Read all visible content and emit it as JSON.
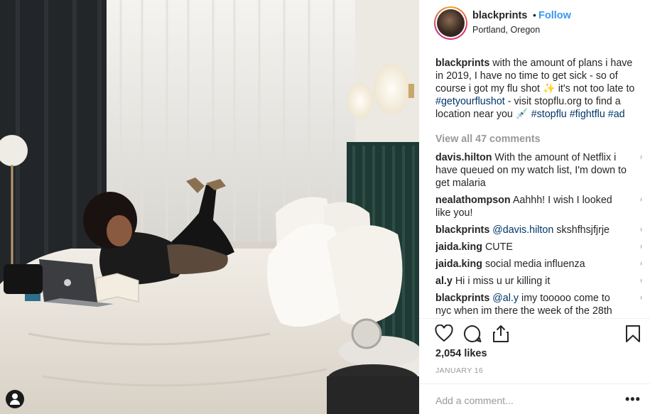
{
  "post": {
    "username": "blackprints",
    "dot": "•",
    "follow_label": "Follow",
    "location": "Portland, Oregon"
  },
  "caption": {
    "username": "blackprints",
    "text_1": "with the amount of plans i have in 2019, I have no time to get sick - so of course i got my flu shot ✨ it's not too late to",
    "tag_1": "#getyourflushot",
    "text_2": "- visit stopflu.org to find a location near you 💉",
    "tag_2": "#stopflu",
    "tag_3": "#fightflu",
    "tag_4": "#ad"
  },
  "view_all_label": "View all 47 comments",
  "comments": [
    {
      "user": "davis.hilton",
      "text": "With the amount of Netflix i have queued on my watch list, I'm down to get malaria"
    },
    {
      "user": "nealathompson",
      "text": "Aahhh! I wish I looked like you!"
    },
    {
      "user": "blackprints",
      "mention": "@davis.hilton",
      "text": "skshfhsjfjrje"
    },
    {
      "user": "jaida.king",
      "text": "CUTE"
    },
    {
      "user": "jaida.king",
      "text": "social media influenza"
    },
    {
      "user": "al.y",
      "text": "Hi i miss u ur killing it"
    },
    {
      "user": "blackprints",
      "mention": "@al.y",
      "text": "imy tooooo come to nyc when im there the week of the 28th"
    }
  ],
  "likes": "2,054 likes",
  "date": "JANUARY 16",
  "add_comment_placeholder": "Add a comment...",
  "more_label": "•••",
  "icons": {
    "like": "heart-icon",
    "comment": "comment-icon",
    "share": "share-icon",
    "save": "bookmark-icon",
    "comment_like": "heart-icon",
    "user_tag": "user-tag-icon"
  },
  "colors": {
    "link_blue": "#3897f0",
    "hashtag": "#003569",
    "muted": "#999999",
    "text": "#262626"
  }
}
